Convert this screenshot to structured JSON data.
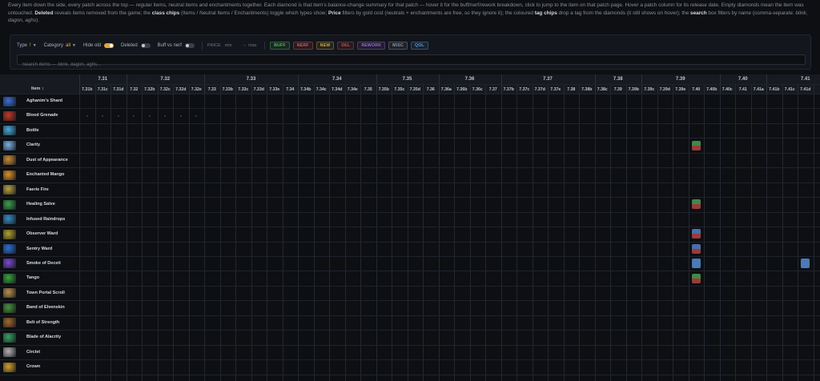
{
  "intro": {
    "p1": "Every item down the side, every patch across the top — regular items, neutral items and enchantments together. Each diamond is that item's balance-change summary for that patch — hover it for the buff/nerf/rework breakdown, click to jump to the item on that patch page. Hover a patch column for its release date. Empty diamonds mean the item was untouched. ",
    "deleted_b": "Deleted",
    "p2": " reveals items removed from the game; the ",
    "class_b": "class chips",
    "p3": " (Items / Neutral Items / Enchantments) toggle which types show; ",
    "price_b": "Price",
    "p4": " filters by gold cost (neutrals + enchantments are free, so they ignore it); the coloured ",
    "tag_b": "tag chips",
    "p5": " drop a tag from the diamonds (it still shows on hover); the ",
    "search_b": "search",
    "p6": " box filters by name (comma-separate: ",
    "example": "blink, dagon, aghs",
    "p7": ")."
  },
  "filters": {
    "type_label": "Type",
    "type_value": "!",
    "category_label": "Category",
    "category_value": "all",
    "hide_old_label": "Hide old",
    "deleted_label": "Deleted",
    "buff_nerf_label": "Buff vs nerf",
    "price_label": "PRICE",
    "price_min_placeholder": "min",
    "price_dash": "–",
    "price_max_placeholder": "max",
    "chips": [
      {
        "label": "BUFF",
        "color": "#4fb85a"
      },
      {
        "label": "NERF",
        "color": "#d05a52"
      },
      {
        "label": "NEW",
        "color": "#d2a640"
      },
      {
        "label": "DEL",
        "color": "#c2504a"
      },
      {
        "label": "REWORK",
        "color": "#9a6ad0"
      },
      {
        "label": "MISC",
        "color": "#8a95a5"
      },
      {
        "label": "QOL",
        "color": "#5a9ad8"
      }
    ]
  },
  "search": {
    "placeholder": "Search items — blink, dagon, aghs..."
  },
  "table": {
    "item_header": "Item ↕",
    "major_patches": [
      {
        "label": "7.31",
        "cols": 3
      },
      {
        "label": "7.32",
        "cols": 5
      },
      {
        "label": "7.33",
        "cols": 6
      },
      {
        "label": "7.34",
        "cols": 5
      },
      {
        "label": "7.35",
        "cols": 4
      },
      {
        "label": "7.36",
        "cols": 4
      },
      {
        "label": "7.37",
        "cols": 6
      },
      {
        "label": "7.38",
        "cols": 3
      },
      {
        "label": "7.39",
        "cols": 5
      },
      {
        "label": "7.40",
        "cols": 3
      },
      {
        "label": "7.41",
        "cols": 5
      }
    ],
    "patches": [
      "7.31b",
      "7.31c",
      "7.31d",
      "7.32",
      "7.32b",
      "7.32c",
      "7.32d",
      "7.32e",
      "7.33",
      "7.33b",
      "7.33c",
      "7.33d",
      "7.33e",
      "7.34",
      "7.34b",
      "7.34c",
      "7.34d",
      "7.34e",
      "7.35",
      "7.35b",
      "7.35c",
      "7.35d",
      "7.36",
      "7.36a",
      "7.36b",
      "7.36c",
      "7.37",
      "7.37b",
      "7.37c",
      "7.37d",
      "7.37e",
      "7.38",
      "7.38b",
      "7.38c",
      "7.39",
      "7.39b",
      "7.39c",
      "7.39d",
      "7.39e",
      "7.40",
      "7.40b",
      "7.40c",
      "7.41",
      "7.41a",
      "7.41b",
      "7.41c",
      "7.41d"
    ],
    "items": [
      {
        "name": "Aghanim's Shard",
        "icon": "aghanims-shard-icon",
        "color": "#3b6fd6"
      },
      {
        "name": "Blood Grenade",
        "icon": "blood-grenade-icon",
        "color": "#c0392b",
        "dots": true
      },
      {
        "name": "Bottle",
        "icon": "bottle-icon",
        "color": "#4aa8d8"
      },
      {
        "name": "Clarity",
        "icon": "clarity-icon",
        "color": "#7ab0e0",
        "changes": [
          {
            "patch": "7.40",
            "top": "#3f8a45",
            "bottom": "#9a3b3b"
          }
        ]
      },
      {
        "name": "Dust of Appearance",
        "icon": "dust-of-appearance-icon",
        "color": "#c98a3a"
      },
      {
        "name": "Enchanted Mango",
        "icon": "enchanted-mango-icon",
        "color": "#d8902a"
      },
      {
        "name": "Faerie Fire",
        "icon": "faerie-fire-icon",
        "color": "#b8a040"
      },
      {
        "name": "Healing Salve",
        "icon": "healing-salve-icon",
        "color": "#3aa04a",
        "changes": [
          {
            "patch": "7.40",
            "top": "#3f8a45",
            "bottom": "#9a3b3b"
          }
        ]
      },
      {
        "name": "Infused Raindrops",
        "icon": "infused-raindrops-icon",
        "color": "#3a8ac0"
      },
      {
        "name": "Observer Ward",
        "icon": "observer-ward-icon",
        "color": "#b0a030",
        "changes": [
          {
            "patch": "7.40",
            "top": "#4a6fa8",
            "bottom": "#9a3b3b"
          }
        ]
      },
      {
        "name": "Sentry Ward",
        "icon": "sentry-ward-icon",
        "color": "#2f6fd0",
        "changes": [
          {
            "patch": "7.40",
            "top": "#4a6fa8",
            "bottom": "#9a3b3b"
          }
        ]
      },
      {
        "name": "Smoke of Deceit",
        "icon": "smoke-of-deceit-icon",
        "color": "#7a4ad0",
        "changes": [
          {
            "patch": "7.40",
            "top": "#4a7ab8",
            "bottom": "#4a7ab8"
          },
          {
            "patch": "7.41d",
            "top": "#4a7ab8",
            "bottom": "#4a7ab8"
          }
        ]
      },
      {
        "name": "Tango",
        "icon": "tango-icon",
        "color": "#3aa040",
        "changes": [
          {
            "patch": "7.40",
            "top": "#3f8a45",
            "bottom": "#9a3b3b"
          }
        ]
      },
      {
        "name": "Town Portal Scroll",
        "icon": "town-portal-scroll-icon",
        "color": "#b89050"
      },
      {
        "name": "Band of Elvenskin",
        "icon": "band-of-elvenskin-icon",
        "color": "#4a9040"
      },
      {
        "name": "Belt of Strength",
        "icon": "belt-of-strength-icon",
        "color": "#a06830"
      },
      {
        "name": "Blade of Alacrity",
        "icon": "blade-of-alacrity-icon",
        "color": "#3aa060"
      },
      {
        "name": "Circlet",
        "icon": "circlet-icon",
        "color": "#b0b0b0"
      },
      {
        "name": "Crown",
        "icon": "crown-icon",
        "color": "#d0a030"
      }
    ]
  }
}
